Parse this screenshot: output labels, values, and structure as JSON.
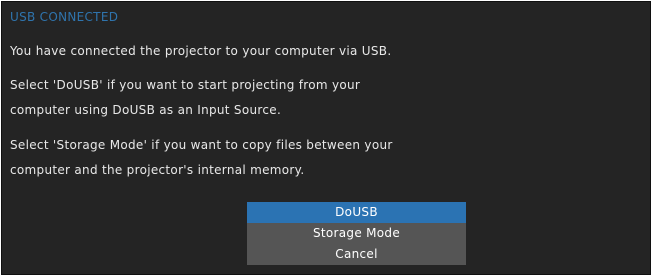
{
  "dialog": {
    "title": "USB CONNECTED",
    "lines": [
      "You have connected the projector to your computer via USB.",
      "Select 'DoUSB' if you want to start projecting from your",
      "computer using DoUSB as an Input Source.",
      "Select 'Storage Mode' if you want to copy files between your",
      "computer and the projector's internal memory."
    ],
    "options": [
      {
        "label": "DoUSB",
        "selected": true
      },
      {
        "label": "Storage Mode",
        "selected": false
      },
      {
        "label": "Cancel",
        "selected": false
      }
    ],
    "colors": {
      "background": "#242424",
      "title": "#2f74ad",
      "text": "#e8e8e8",
      "option_selected": "#2b73b3",
      "option": "#555555"
    }
  }
}
